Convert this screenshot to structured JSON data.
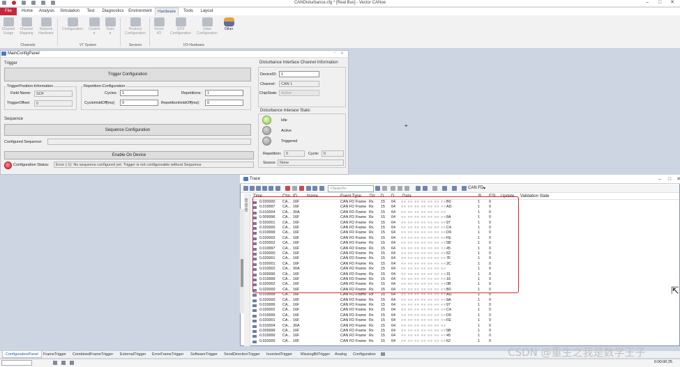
{
  "window": {
    "title": "CANDisturbance.cfg * [Real Bus] - Vector CANoe",
    "minimize": "–",
    "close": "✕",
    "maximize": "□"
  },
  "ribbon": {
    "tabs": [
      "File",
      "Home",
      "Analysis",
      "Simulation",
      "Test",
      "Diagnostics",
      "Environment",
      "Hardware",
      "Tools",
      "Layout"
    ],
    "active_tab": "Hardware",
    "buttons": [
      {
        "label1": "Channel",
        "label2": "Usage",
        "enabled": false
      },
      {
        "label1": "Channel",
        "label2": "Mapping",
        "enabled": false
      },
      {
        "label1": "Network",
        "label2": "Hardware",
        "enabled": false
      },
      {
        "label1": "Configuration",
        "label2": "",
        "enabled": false
      },
      {
        "label1": "Control",
        "label2": "▾",
        "enabled": false
      },
      {
        "label1": "Tools",
        "label2": "▾",
        "enabled": false
      },
      {
        "label1": "Protocol",
        "label2": "Configuration",
        "enabled": false
      },
      {
        "label1": "Vector",
        "label2": "I/O",
        "enabled": false
      },
      {
        "label1": "GPS",
        "label2": "Configuration",
        "enabled": false
      },
      {
        "label1": "Video",
        "label2": "Configuration",
        "enabled": false
      },
      {
        "label1": "Other",
        "label2": "",
        "enabled": true
      }
    ],
    "groups": [
      "Channels",
      "VT System",
      "Sensors",
      "I/O-Hardware"
    ]
  },
  "panel": {
    "title": "MainConfigPanel",
    "trigger_section": "Trigger",
    "trigger_config_btn": "Trigger Configuration",
    "trigger_pos_group": "TriggerPosition-Information",
    "field_name_label": "Field Name:",
    "field_name_value": "SOF",
    "trigger_offset_label": "TriggerOffset:",
    "trigger_offset_value": "0",
    "repetition_group": "Repetition-Configuration",
    "cycles_label": "Cycles:",
    "cycles_value": "1",
    "repetitions_label": "Repetitions:",
    "repetitions_value": "1",
    "cycle_holdoff_label": "CycleHoldOff[ms]:",
    "cycle_holdoff_value": "0",
    "rep_holdoff_label": "RepetitionHoldOff[ms]:",
    "rep_holdoff_value": "0",
    "sequence_section": "Sequence",
    "sequence_config_btn": "Sequence Configuration",
    "configured_sequence_label": "Configured Sequence:",
    "configured_sequence_value": "",
    "enable_btn": "Enable On Device",
    "config_status_label": "Configuration Status:",
    "config_status_value": "Error (-1): No sequence configured yet. Trigger is not configureable without Sequence",
    "channel_info_title": "Disturbance Interface Channel Information",
    "device_id_label": "DeviceID:",
    "device_id_value": "1",
    "channel_label": "Channel:",
    "channel_value": "CAN 1",
    "chipstate_label": "ChipState:",
    "chipstate_value": "Active",
    "state_title": "Disturbance Interace State:",
    "state_idle": "Idle",
    "state_active": "Active",
    "state_triggered": "Triggered",
    "repetition_label": "Repetition:",
    "repetition_value": "0",
    "cycle_label": "Cycle:",
    "cycle_value": "0",
    "source_label": "Source:",
    "source_value": "None"
  },
  "trace": {
    "title": "Trace",
    "search_placeholder": "<Search>",
    "filter_label": "CAN FD",
    "time_axis": "00:00:00",
    "columns": [
      "Time",
      "Chn",
      "ID",
      "Name",
      "Event Type",
      "Dir",
      "D...",
      "D...",
      "Data",
      "B...",
      "ESI",
      "Update...",
      "Validation State"
    ],
    "rows": [
      {
        "time": "0.020000",
        "chn": "CA...",
        "id": "16F",
        "event": "CAN FD Frame",
        "dir": "Rx",
        "d1": "15",
        "d2": "64",
        "last": "B0",
        "b": "1",
        "esi": "0"
      },
      {
        "time": "0.019997",
        "chn": "CA...",
        "id": "16F",
        "event": "CAN FD Frame",
        "dir": "Rx",
        "d1": "15",
        "d2": "64",
        "last": "AD",
        "b": "1",
        "esi": "0"
      },
      {
        "time": "0.010004",
        "chn": "CA...",
        "id": "30A",
        "event": "CAN FD Frame",
        "dir": "Rx",
        "d1": "15",
        "d2": "64",
        "last": "",
        "b": "1",
        "esi": "0"
      },
      {
        "time": "0.009996",
        "chn": "CA...",
        "id": "16F",
        "event": "CAN FD Frame",
        "dir": "Rx",
        "d1": "15",
        "d2": "64",
        "last": "8A",
        "b": "1",
        "esi": "0"
      },
      {
        "time": "0.020001",
        "chn": "CA...",
        "id": "16F",
        "event": "CAN FD Frame",
        "dir": "Rx",
        "d1": "15",
        "d2": "64",
        "last": "97",
        "b": "1",
        "esi": "0"
      },
      {
        "time": "0.020000",
        "chn": "CA...",
        "id": "16F",
        "event": "CAN FD Frame",
        "dir": "Rx",
        "d1": "15",
        "d2": "64",
        "last": "C4",
        "b": "1",
        "esi": "0"
      },
      {
        "time": "0.019999",
        "chn": "CA...",
        "id": "16F",
        "event": "CAN FD Frame",
        "dir": "Rx",
        "d1": "15",
        "d2": "64",
        "last": "D9",
        "b": "1",
        "esi": "0"
      },
      {
        "time": "0.020002",
        "chn": "CA...",
        "id": "16F",
        "event": "CAN FD Frame",
        "dir": "Rx",
        "d1": "15",
        "d2": "64",
        "last": "FE",
        "b": "1",
        "esi": "0"
      },
      {
        "time": "0.020002",
        "chn": "CA...",
        "id": "16F",
        "event": "CAN FD Frame",
        "dir": "Rx",
        "d1": "15",
        "d2": "64",
        "last": "5B",
        "b": "1",
        "esi": "0"
      },
      {
        "time": "0.019997",
        "chn": "CA...",
        "id": "16F",
        "event": "CAN FD Frame",
        "dir": "Rx",
        "d1": "15",
        "d2": "64",
        "last": "45",
        "b": "1",
        "esi": "0"
      },
      {
        "time": "0.020000",
        "chn": "CA...",
        "id": "16F",
        "event": "CAN FD Frame",
        "dir": "Rx",
        "d1": "15",
        "d2": "64",
        "last": "62",
        "b": "1",
        "esi": "0"
      },
      {
        "time": "0.020001",
        "chn": "CA...",
        "id": "16F",
        "event": "CAN FD Frame",
        "dir": "Rx",
        "d1": "15",
        "d2": "64",
        "last": "7F",
        "b": "1",
        "esi": "0"
      },
      {
        "time": "0.020001",
        "chn": "CA...",
        "id": "16F",
        "event": "CAN FD Frame",
        "dir": "Rx",
        "d1": "15",
        "d2": "64",
        "last": "2C",
        "b": "1",
        "esi": "0"
      },
      {
        "time": "0.010002",
        "chn": "CA...",
        "id": "30A",
        "event": "CAN FD Frame",
        "dir": "Rx",
        "d1": "15",
        "d2": "64",
        "last": "",
        "b": "1",
        "esi": "0"
      },
      {
        "time": "0.009996",
        "chn": "CA...",
        "id": "16F",
        "event": "CAN FD Frame",
        "dir": "Rx",
        "d1": "15",
        "d2": "64",
        "last": "31",
        "b": "1",
        "esi": "0"
      },
      {
        "time": "0.019999",
        "chn": "CA...",
        "id": "16F",
        "event": "CAN FD Frame",
        "dir": "Rx",
        "d1": "15",
        "d2": "64",
        "last": "16",
        "b": "1",
        "esi": "0"
      },
      {
        "time": "0.020002",
        "chn": "CA...",
        "id": "16F",
        "event": "CAN FD Frame",
        "dir": "Rx",
        "d1": "15",
        "d2": "64",
        "last": "0B",
        "b": "1",
        "esi": "0"
      },
      {
        "time": "0.020000",
        "chn": "CA...",
        "id": "16F",
        "event": "CAN FD Frame",
        "dir": "Rx",
        "d1": "15",
        "d2": "64",
        "last": "B0",
        "b": "1",
        "esi": "0"
      },
      {
        "time": "0.019999",
        "chn": "CA...",
        "id": "16F",
        "event": "CAN FD Frame",
        "dir": "Rx",
        "d1": "15",
        "d2": "64",
        "last": "AD",
        "b": "1",
        "esi": "0"
      },
      {
        "time": "0.020000",
        "chn": "CA...",
        "id": "16F",
        "event": "CAN FD Frame",
        "dir": "Rx",
        "d1": "15",
        "d2": "64",
        "last": "8A",
        "b": "1",
        "esi": "0"
      },
      {
        "time": "0.019999",
        "chn": "CA...",
        "id": "16F",
        "event": "CAN FD Frame",
        "dir": "Rx",
        "d1": "15",
        "d2": "64",
        "last": "97",
        "b": "1",
        "esi": "0"
      },
      {
        "time": "0.020002",
        "chn": "CA...",
        "id": "16F",
        "event": "CAN FD Frame",
        "dir": "Rx",
        "d1": "15",
        "d2": "64",
        "last": "C4",
        "b": "1",
        "esi": "0"
      },
      {
        "time": "0.019999",
        "chn": "CA...",
        "id": "16F",
        "event": "CAN FD Frame",
        "dir": "Rx",
        "d1": "15",
        "d2": "64",
        "last": "D9",
        "b": "1",
        "esi": "0"
      },
      {
        "time": "0.020001",
        "chn": "CA...",
        "id": "16F",
        "event": "CAN FD Frame",
        "dir": "Rx",
        "d1": "15",
        "d2": "64",
        "last": "FE",
        "b": "1",
        "esi": "0"
      },
      {
        "time": "0.010004",
        "chn": "CA...",
        "id": "30A",
        "event": "CAN FD Frame",
        "dir": "Rx",
        "d1": "15",
        "d2": "64",
        "last": "",
        "b": "1",
        "esi": "0"
      },
      {
        "time": "0.009999",
        "chn": "CA...",
        "id": "16F",
        "event": "CAN FD Frame",
        "dir": "Rx",
        "d1": "15",
        "d2": "64",
        "last": "5B",
        "b": "1",
        "esi": "0"
      },
      {
        "time": "0.019999",
        "chn": "CA...",
        "id": "16F",
        "event": "CAN FD Frame",
        "dir": "Rx",
        "d1": "15",
        "d2": "64",
        "last": "45",
        "b": "1",
        "esi": "0"
      },
      {
        "time": "0.020000",
        "chn": "CA...",
        "id": "16F",
        "event": "CAN FD Frame",
        "dir": "Rx",
        "d1": "15",
        "d2": "64",
        "last": "62",
        "b": "1",
        "esi": "0"
      }
    ]
  },
  "bottom_tabs": [
    "ConfigurationPanel",
    "FrameTrigger",
    "CombinedFrameTrigger",
    "ExternalTrigger",
    "ErrorFrameTrigger",
    "SoftwareTrigger",
    "SendDirectionTrigger",
    "InvertedTrigger",
    "MissingBitTrigger",
    "Analog",
    "Configuration"
  ],
  "status": {
    "clock": "0:00:00:25",
    "watermark": "CSDN @重生之我是数学王子"
  },
  "colors": {
    "accent": "#c8283b",
    "highlight": "#d2262f",
    "desktop": "#cdd5e3"
  }
}
